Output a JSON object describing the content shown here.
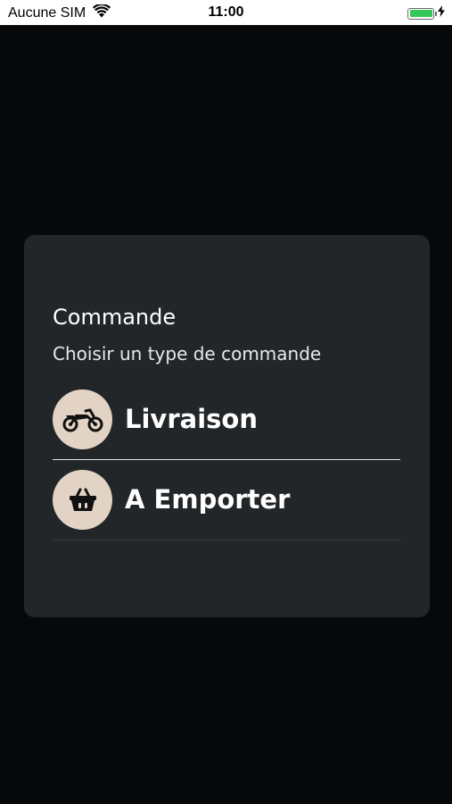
{
  "status_bar": {
    "carrier": "Aucune SIM",
    "time": "11:00",
    "battery_level": 1.0,
    "battery_color": "#35c759",
    "wifi_icon": "wifi-icon",
    "charging_icon": "bolt-icon"
  },
  "dialog": {
    "title": "Commande",
    "subtitle": "Choisir un type de commande",
    "options": [
      {
        "label": "Livraison",
        "icon": "motorbike-icon"
      },
      {
        "label": "A Emporter",
        "icon": "basket-icon"
      }
    ]
  },
  "colors": {
    "background": "#070809",
    "card": "#232628",
    "icon_circle": "#e3d3c4"
  }
}
